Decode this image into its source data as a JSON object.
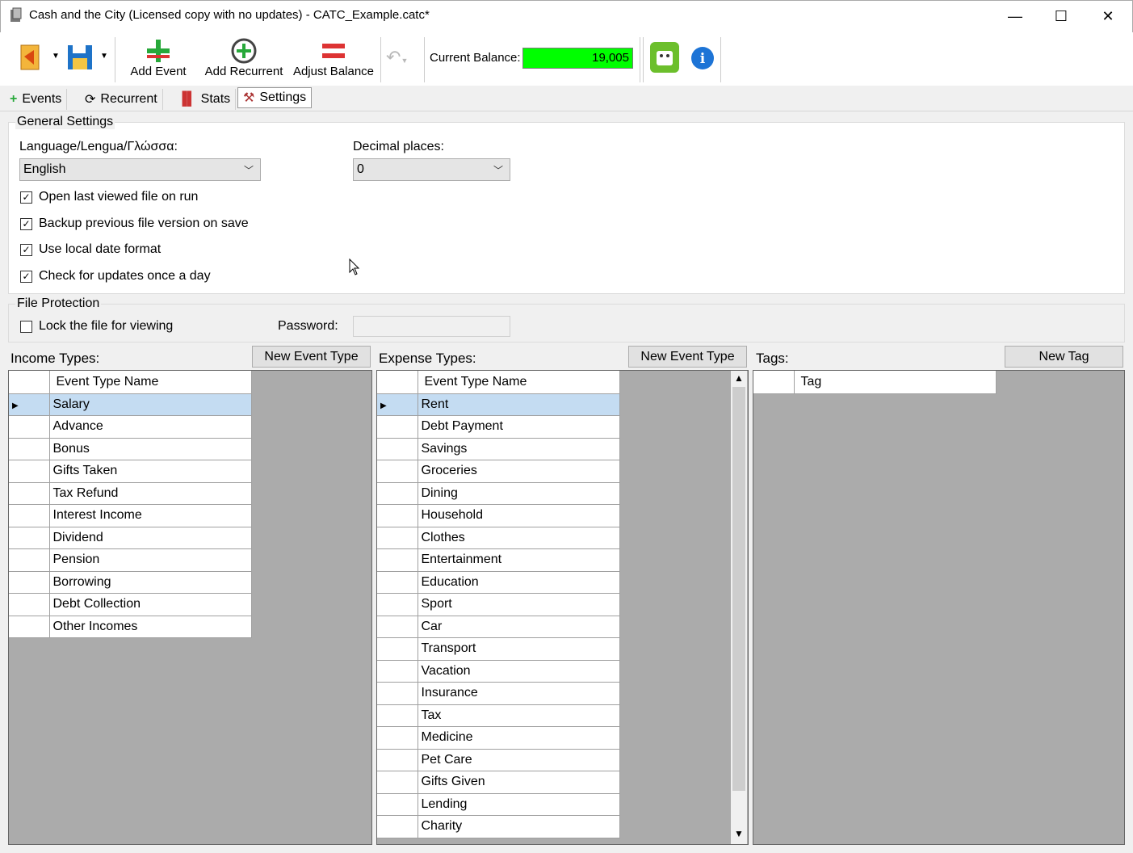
{
  "window": {
    "title": "Cash and the City (Licensed copy with no updates) - CATC_Example.catc*",
    "minimize": "—",
    "maximize": "☐",
    "close": "✕"
  },
  "toolbar": {
    "add_event": "Add Event",
    "add_recurrent": "Add Recurrent",
    "adjust_balance": "Adjust Balance",
    "balance_label": "Current Balance:",
    "balance_value": "19,005",
    "balance_color": "#00ff00"
  },
  "tabs": [
    {
      "label": "Events",
      "icon": "plus-icon"
    },
    {
      "label": "Recurrent",
      "icon": "recurrent-icon"
    },
    {
      "label": "Stats",
      "icon": "stats-icon"
    },
    {
      "label": "Settings",
      "icon": "settings-icon"
    }
  ],
  "general": {
    "group_label": "General Settings",
    "language_label": "Language/Lengua/Γλώσσα:",
    "language_value": "English",
    "decimal_label": "Decimal places:",
    "decimal_value": "0",
    "checkboxes": [
      {
        "label": "Open last viewed file on run",
        "checked": true
      },
      {
        "label": "Backup previous file version on save",
        "checked": true
      },
      {
        "label": "Use local date format",
        "checked": true
      },
      {
        "label": "Check for updates once a day",
        "checked": true
      }
    ]
  },
  "protection": {
    "group_label": "File Protection",
    "lock_label": "Lock the file for viewing",
    "lock_checked": false,
    "password_label": "Password:",
    "password_value": ""
  },
  "income": {
    "label": "Income Types:",
    "new_button": "New Event Type",
    "column": "Event Type Name",
    "rows": [
      "Salary",
      "Advance",
      "Bonus",
      "Gifts Taken",
      "Tax Refund",
      "Interest Income",
      "Dividend",
      "Pension",
      "Borrowing",
      "Debt Collection",
      "Other Incomes"
    ]
  },
  "expense": {
    "label": "Expense Types:",
    "new_button": "New Event Type",
    "column": "Event Type Name",
    "rows": [
      "Rent",
      "Debt Payment",
      "Savings",
      "Groceries",
      "Dining",
      "Household",
      "Clothes",
      "Entertainment",
      "Education",
      "Sport",
      "Car",
      "Transport",
      "Vacation",
      "Insurance",
      "Tax",
      "Medicine",
      "Pet Care",
      "Gifts Given",
      "Lending",
      "Charity"
    ]
  },
  "tags": {
    "label": "Tags:",
    "new_button": "New Tag",
    "column": "Tag"
  }
}
